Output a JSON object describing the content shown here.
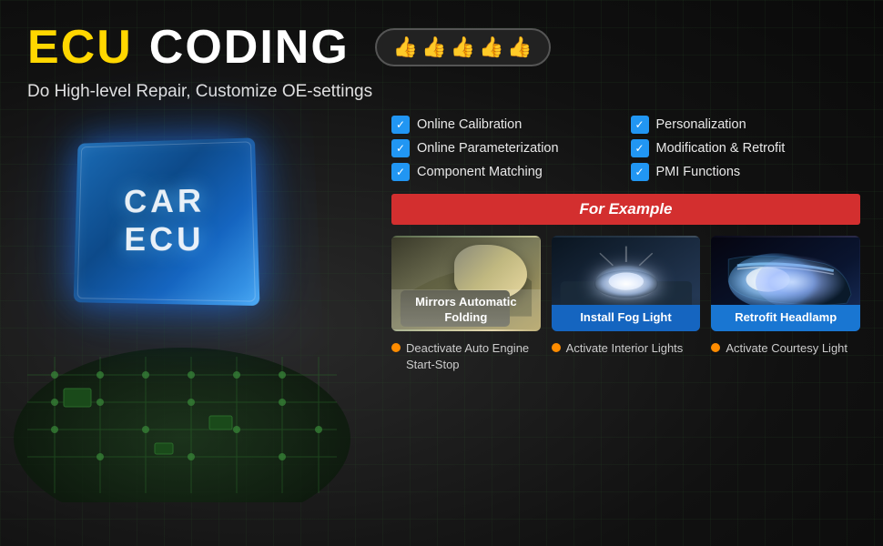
{
  "header": {
    "title_ecu": "ECU",
    "title_coding": "CODING",
    "subtitle": "Do High-level Repair, Customize OE-settings",
    "thumbs": [
      "👍",
      "👍",
      "👍",
      "👍",
      "👍"
    ]
  },
  "ecu_chip": {
    "line1": "CAR",
    "line2": "ECU"
  },
  "features": [
    {
      "label": "Online Calibration"
    },
    {
      "label": "Personalization"
    },
    {
      "label": "Online Parameterization"
    },
    {
      "label": "Modification & Retrofit"
    },
    {
      "label": "Component Matching"
    },
    {
      "label": "PMI Functions"
    }
  ],
  "for_example_label": "For Example",
  "example_cards": [
    {
      "label": "Mirrors Automatic Folding",
      "style": "white"
    },
    {
      "label": "Install Fog Light",
      "style": "blue"
    },
    {
      "label": "Retrofit Headlamp",
      "style": "blue2"
    }
  ],
  "bottom_items": [
    {
      "text": "Deactivate Auto Engine Start-Stop"
    },
    {
      "text": "Activate Interior Lights"
    },
    {
      "text": "Activate Courtesy Light"
    }
  ]
}
